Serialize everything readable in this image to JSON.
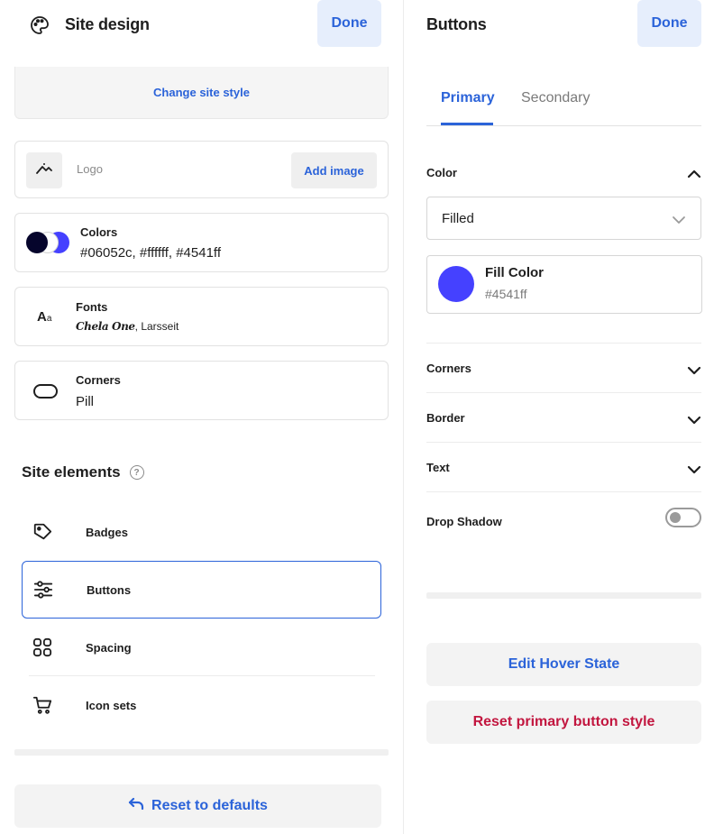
{
  "colors": {
    "accent": "#2b63d9",
    "danger": "#c2163f",
    "swatch_1": "#06052c",
    "swatch_2": "#ffffff",
    "swatch_3": "#4541ff"
  },
  "left_panel": {
    "title": "Site design",
    "done_label": "Done",
    "change_style_label": "Change site style",
    "logo": {
      "label": "Logo",
      "add_image_label": "Add image"
    },
    "colors_card": {
      "title": "Colors",
      "value": "#06052c, #ffffff, #4541ff"
    },
    "fonts_card": {
      "title": "Fonts",
      "heading_font": "Chela One",
      "separator": ",",
      "body_font": "Larsseit"
    },
    "corners_card": {
      "title": "Corners",
      "value": "Pill"
    },
    "site_elements": {
      "title": "Site elements",
      "help_glyph": "?",
      "items": [
        {
          "label": "Badges",
          "icon": "tag-icon"
        },
        {
          "label": "Buttons",
          "icon": "sliders-icon"
        },
        {
          "label": "Spacing",
          "icon": "grid-icon"
        },
        {
          "label": "Icon sets",
          "icon": "cart-icon"
        }
      ]
    },
    "reset_defaults_label": "Reset to defaults"
  },
  "right_panel": {
    "title": "Buttons",
    "done_label": "Done",
    "tabs": [
      {
        "label": "Primary",
        "active": true
      },
      {
        "label": "Secondary",
        "active": false
      }
    ],
    "color_section": {
      "title": "Color",
      "select_value": "Filled",
      "fill_title": "Fill Color",
      "fill_value": "#4541ff"
    },
    "accordions": [
      {
        "label": "Corners"
      },
      {
        "label": "Border"
      },
      {
        "label": "Text"
      }
    ],
    "drop_shadow": {
      "label": "Drop Shadow",
      "enabled": false
    },
    "edit_hover_label": "Edit Hover State",
    "reset_primary_label": "Reset primary button style"
  }
}
